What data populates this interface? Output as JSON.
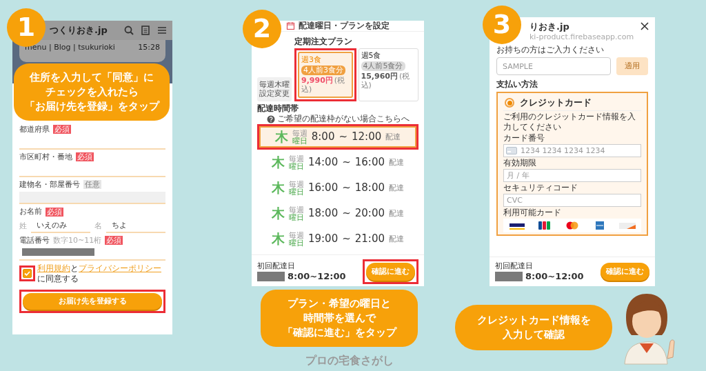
{
  "panels": [
    {
      "kind": "address",
      "number": "1",
      "caption": [
        "住所を入力して「同意」に",
        "チェックを入れたら",
        "「お届け先を登録」をタップ"
      ],
      "screen": {
        "title": "つくりおき.jp",
        "chat": {
          "text": "menu | Blog | tsukurioki",
          "time": "15:28"
        },
        "fields": [
          {
            "label": "都道府県",
            "tag": "必須",
            "required": true
          },
          {
            "label": "市区町村・番地",
            "tag": "必須",
            "required": true
          },
          {
            "label": "建物名・部屋番号",
            "tag": "任意",
            "required": false
          }
        ],
        "name": {
          "label": "お名前",
          "tag": "必須",
          "required": true,
          "parts": [
            {
              "label": "姓",
              "value": "いえのみ"
            },
            {
              "label": "名",
              "value": "ちよ"
            }
          ]
        },
        "phone_number": {
          "label": "電話番号",
          "hint": "数字10~11桁",
          "tag": "必須",
          "required": true
        },
        "consent": {
          "checked": true,
          "highlighted": true,
          "parts": [
            {
              "kind": "link",
              "text": "利用規約"
            },
            {
              "kind": "text",
              "text": "と"
            },
            {
              "kind": "link",
              "text": "プライバシーポリシー"
            },
            {
              "kind": "text",
              "text": "に同意する"
            }
          ]
        },
        "submit": {
          "label": "お届け先を登録する",
          "highlighted": true
        }
      }
    },
    {
      "kind": "plan",
      "number": "2",
      "caption": [
        "プラン・希望の曜日と",
        "時間帯を選んで",
        "「確認に進む」をタップ"
      ],
      "screen": {
        "title": "配達曜日・プランを設定",
        "notice_lines": [
          "毎週木曜",
          "設定変更"
        ],
        "plan_heading": "定期注文プラン",
        "plans": [
          {
            "name": "週3食",
            "badge": "4人前3食分",
            "price": "9,990円",
            "tax": "(税込)",
            "selected": true,
            "highlighted": true
          },
          {
            "name": "週5食",
            "badge": "4人前5食分",
            "price": "15,960円",
            "tax": "(税込)",
            "selected": false,
            "highlighted": false
          }
        ],
        "slots_heading": "配達時間帯",
        "help": "ご希望の配達枠がない場合こちらへ",
        "slots": [
          {
            "day": "木",
            "freq": "毎週",
            "unit": "曜日",
            "start": "8:00",
            "sep": "~",
            "end": "12:00",
            "suffix": "配達",
            "selected": true,
            "highlighted": true
          },
          {
            "day": "木",
            "freq": "毎週",
            "unit": "曜日",
            "start": "14:00",
            "sep": "~",
            "end": "16:00",
            "suffix": "配達",
            "selected": false,
            "highlighted": false
          },
          {
            "day": "木",
            "freq": "毎週",
            "unit": "曜日",
            "start": "16:00",
            "sep": "~",
            "end": "18:00",
            "suffix": "配達",
            "selected": false,
            "highlighted": false
          },
          {
            "day": "木",
            "freq": "毎週",
            "unit": "曜日",
            "start": "18:00",
            "sep": "~",
            "end": "20:00",
            "suffix": "配達",
            "selected": false,
            "highlighted": false
          },
          {
            "day": "木",
            "freq": "毎週",
            "unit": "曜日",
            "start": "19:00",
            "sep": "~",
            "end": "21:00",
            "suffix": "配達",
            "selected": false,
            "highlighted": false
          }
        ],
        "footer": {
          "label": "初回配達日",
          "time": "8:00~12:00",
          "button": "確認に進む",
          "highlighted": true
        }
      }
    },
    {
      "kind": "payment",
      "number": "3",
      "caption": [
        "クレジットカード情報を",
        "入力して確認"
      ],
      "screen": {
        "title": "りおき.jp",
        "url": "ki-product.firebaseapp.com",
        "coupon": {
          "prompt": "お持ちの方はご入力ください",
          "placeholder": "SAMPLE",
          "button": "適用",
          "disabled": true
        },
        "payment_heading": "支払い方法",
        "method": {
          "label": "クレジットカード",
          "selected": true,
          "instruction": "ご利用のクレジットカード情報を入力してください",
          "fields": [
            {
              "label": "カード番号",
              "placeholder": "1234 1234 1234 1234",
              "kind": "card"
            },
            {
              "label": "有効期限",
              "placeholder": "月 / 年",
              "kind": "plain"
            },
            {
              "label": "セキュリティコード",
              "placeholder": "CVC",
              "kind": "plain"
            }
          ],
          "cards_label": "利用可能カード",
          "cards": [
            {
              "kind": "visa"
            },
            {
              "kind": "jcb"
            },
            {
              "kind": "master"
            },
            {
              "kind": "amex"
            },
            {
              "kind": "discover"
            }
          ]
        },
        "footer": {
          "label": "初回配達日",
          "time": "8:00~12:00",
          "button": "確認に進む",
          "highlighted": false
        }
      }
    }
  ],
  "site_credit": "プロの宅食さがし"
}
